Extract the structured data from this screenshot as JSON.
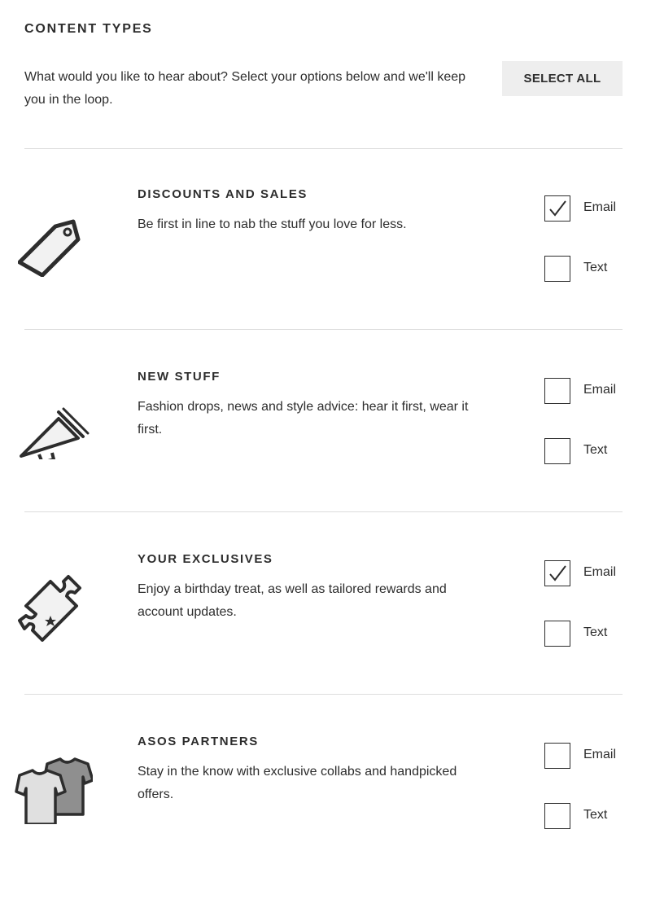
{
  "header": {
    "title": "CONTENT TYPES",
    "description": "What would you like to hear about? Select your options below and we'll keep you in the loop.",
    "select_all_label": "SELECT ALL"
  },
  "categories": [
    {
      "title": "DISCOUNTS AND SALES",
      "description": "Be first in line to nab the stuff you love for less.",
      "icon": "tag-icon",
      "email": {
        "label": "Email",
        "checked": true
      },
      "text": {
        "label": "Text",
        "checked": false
      }
    },
    {
      "title": "NEW STUFF",
      "description": "Fashion drops, news and style advice: hear it first, wear it first.",
      "icon": "megaphone-icon",
      "email": {
        "label": "Email",
        "checked": false
      },
      "text": {
        "label": "Text",
        "checked": false
      }
    },
    {
      "title": "YOUR EXCLUSIVES",
      "description": "Enjoy a birthday treat, as well as tailored rewards and account updates.",
      "icon": "ticket-icon",
      "email": {
        "label": "Email",
        "checked": true
      },
      "text": {
        "label": "Text",
        "checked": false
      }
    },
    {
      "title": "ASOS PARTNERS",
      "description": "Stay in the know with exclusive collabs and handpicked offers.",
      "icon": "tshirts-icon",
      "email": {
        "label": "Email",
        "checked": false
      },
      "text": {
        "label": "Text",
        "checked": false
      }
    }
  ]
}
